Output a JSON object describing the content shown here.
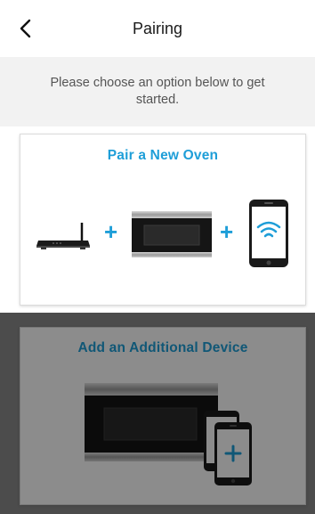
{
  "header": {
    "title": "Pairing",
    "back_icon": "chevron-left-icon"
  },
  "intro": {
    "text": "Please choose an option below to get started."
  },
  "options": [
    {
      "title": "Pair a New Oven",
      "icons": [
        "router-icon",
        "plus-icon",
        "oven-icon",
        "plus-icon",
        "phone-wifi-icon"
      ]
    },
    {
      "title": "Add an Additional Device",
      "icons": [
        "oven-icon",
        "add-device-icon"
      ]
    }
  ],
  "colors": {
    "accent": "#1e9ed8",
    "subheader_bg": "#f2f2f2"
  }
}
